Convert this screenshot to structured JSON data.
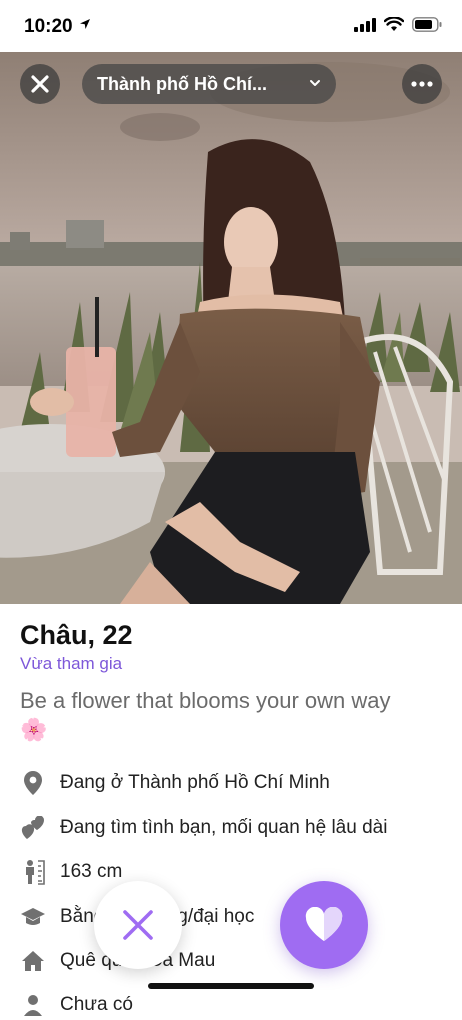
{
  "status": {
    "time": "10:20"
  },
  "top_bar": {
    "location": "Thành phố Hồ Chí..."
  },
  "profile": {
    "name_age": "Châu, 22",
    "joined": "Vừa tham gia",
    "bio": "Be a flower that blooms your own way",
    "bio_emoji": "🌸",
    "info": [
      {
        "icon": "location-pin-icon",
        "label": "Đang ở Thành phố Hồ Chí Minh"
      },
      {
        "icon": "hearts-icon",
        "label": "Đang tìm tình bạn, mối quan hệ lâu dài"
      },
      {
        "icon": "height-icon",
        "label": "163 cm"
      },
      {
        "icon": "graduation-cap-icon",
        "label": "Bằng cao đẳng/đại học"
      },
      {
        "icon": "home-icon",
        "label": "Quê quán Cà Mau"
      },
      {
        "icon": "person-icon",
        "label": "Chưa có"
      }
    ]
  },
  "colors": {
    "accent": "#9f6cf2",
    "joined": "#7d57d9"
  }
}
